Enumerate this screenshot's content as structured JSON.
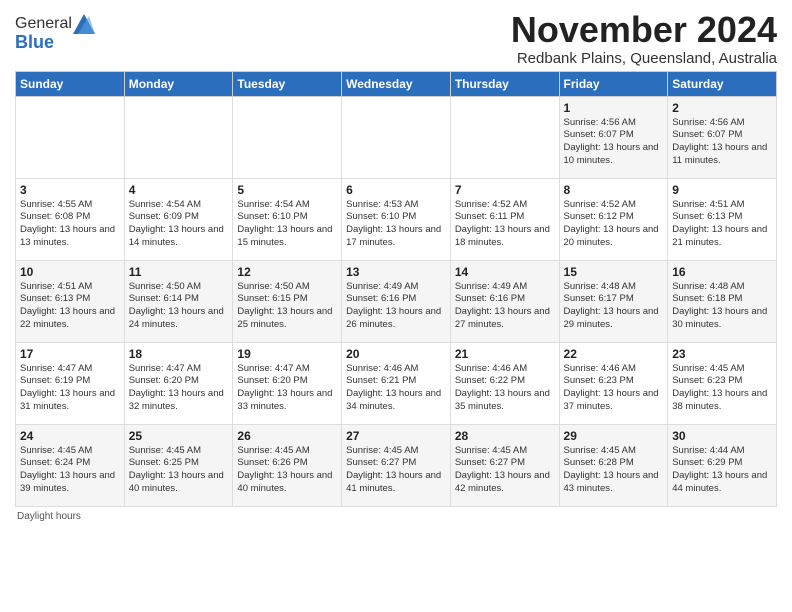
{
  "header": {
    "logo_general": "General",
    "logo_blue": "Blue",
    "month_title": "November 2024",
    "subtitle": "Redbank Plains, Queensland, Australia"
  },
  "days_of_week": [
    "Sunday",
    "Monday",
    "Tuesday",
    "Wednesday",
    "Thursday",
    "Friday",
    "Saturday"
  ],
  "weeks": [
    [
      {
        "day": "",
        "info": ""
      },
      {
        "day": "",
        "info": ""
      },
      {
        "day": "",
        "info": ""
      },
      {
        "day": "",
        "info": ""
      },
      {
        "day": "",
        "info": ""
      },
      {
        "day": "1",
        "info": "Sunrise: 4:56 AM\nSunset: 6:07 PM\nDaylight: 13 hours\nand 10 minutes."
      },
      {
        "day": "2",
        "info": "Sunrise: 4:56 AM\nSunset: 6:07 PM\nDaylight: 13 hours\nand 11 minutes."
      }
    ],
    [
      {
        "day": "3",
        "info": "Sunrise: 4:55 AM\nSunset: 6:08 PM\nDaylight: 13 hours\nand 13 minutes."
      },
      {
        "day": "4",
        "info": "Sunrise: 4:54 AM\nSunset: 6:09 PM\nDaylight: 13 hours\nand 14 minutes."
      },
      {
        "day": "5",
        "info": "Sunrise: 4:54 AM\nSunset: 6:10 PM\nDaylight: 13 hours\nand 15 minutes."
      },
      {
        "day": "6",
        "info": "Sunrise: 4:53 AM\nSunset: 6:10 PM\nDaylight: 13 hours\nand 17 minutes."
      },
      {
        "day": "7",
        "info": "Sunrise: 4:52 AM\nSunset: 6:11 PM\nDaylight: 13 hours\nand 18 minutes."
      },
      {
        "day": "8",
        "info": "Sunrise: 4:52 AM\nSunset: 6:12 PM\nDaylight: 13 hours\nand 20 minutes."
      },
      {
        "day": "9",
        "info": "Sunrise: 4:51 AM\nSunset: 6:13 PM\nDaylight: 13 hours\nand 21 minutes."
      }
    ],
    [
      {
        "day": "10",
        "info": "Sunrise: 4:51 AM\nSunset: 6:13 PM\nDaylight: 13 hours\nand 22 minutes."
      },
      {
        "day": "11",
        "info": "Sunrise: 4:50 AM\nSunset: 6:14 PM\nDaylight: 13 hours\nand 24 minutes."
      },
      {
        "day": "12",
        "info": "Sunrise: 4:50 AM\nSunset: 6:15 PM\nDaylight: 13 hours\nand 25 minutes."
      },
      {
        "day": "13",
        "info": "Sunrise: 4:49 AM\nSunset: 6:16 PM\nDaylight: 13 hours\nand 26 minutes."
      },
      {
        "day": "14",
        "info": "Sunrise: 4:49 AM\nSunset: 6:16 PM\nDaylight: 13 hours\nand 27 minutes."
      },
      {
        "day": "15",
        "info": "Sunrise: 4:48 AM\nSunset: 6:17 PM\nDaylight: 13 hours\nand 29 minutes."
      },
      {
        "day": "16",
        "info": "Sunrise: 4:48 AM\nSunset: 6:18 PM\nDaylight: 13 hours\nand 30 minutes."
      }
    ],
    [
      {
        "day": "17",
        "info": "Sunrise: 4:47 AM\nSunset: 6:19 PM\nDaylight: 13 hours\nand 31 minutes."
      },
      {
        "day": "18",
        "info": "Sunrise: 4:47 AM\nSunset: 6:20 PM\nDaylight: 13 hours\nand 32 minutes."
      },
      {
        "day": "19",
        "info": "Sunrise: 4:47 AM\nSunset: 6:20 PM\nDaylight: 13 hours\nand 33 minutes."
      },
      {
        "day": "20",
        "info": "Sunrise: 4:46 AM\nSunset: 6:21 PM\nDaylight: 13 hours\nand 34 minutes."
      },
      {
        "day": "21",
        "info": "Sunrise: 4:46 AM\nSunset: 6:22 PM\nDaylight: 13 hours\nand 35 minutes."
      },
      {
        "day": "22",
        "info": "Sunrise: 4:46 AM\nSunset: 6:23 PM\nDaylight: 13 hours\nand 37 minutes."
      },
      {
        "day": "23",
        "info": "Sunrise: 4:45 AM\nSunset: 6:23 PM\nDaylight: 13 hours\nand 38 minutes."
      }
    ],
    [
      {
        "day": "24",
        "info": "Sunrise: 4:45 AM\nSunset: 6:24 PM\nDaylight: 13 hours\nand 39 minutes."
      },
      {
        "day": "25",
        "info": "Sunrise: 4:45 AM\nSunset: 6:25 PM\nDaylight: 13 hours\nand 40 minutes."
      },
      {
        "day": "26",
        "info": "Sunrise: 4:45 AM\nSunset: 6:26 PM\nDaylight: 13 hours\nand 40 minutes."
      },
      {
        "day": "27",
        "info": "Sunrise: 4:45 AM\nSunset: 6:27 PM\nDaylight: 13 hours\nand 41 minutes."
      },
      {
        "day": "28",
        "info": "Sunrise: 4:45 AM\nSunset: 6:27 PM\nDaylight: 13 hours\nand 42 minutes."
      },
      {
        "day": "29",
        "info": "Sunrise: 4:45 AM\nSunset: 6:28 PM\nDaylight: 13 hours\nand 43 minutes."
      },
      {
        "day": "30",
        "info": "Sunrise: 4:44 AM\nSunset: 6:29 PM\nDaylight: 13 hours\nand 44 minutes."
      }
    ]
  ],
  "footer": {
    "note": "Daylight hours"
  }
}
